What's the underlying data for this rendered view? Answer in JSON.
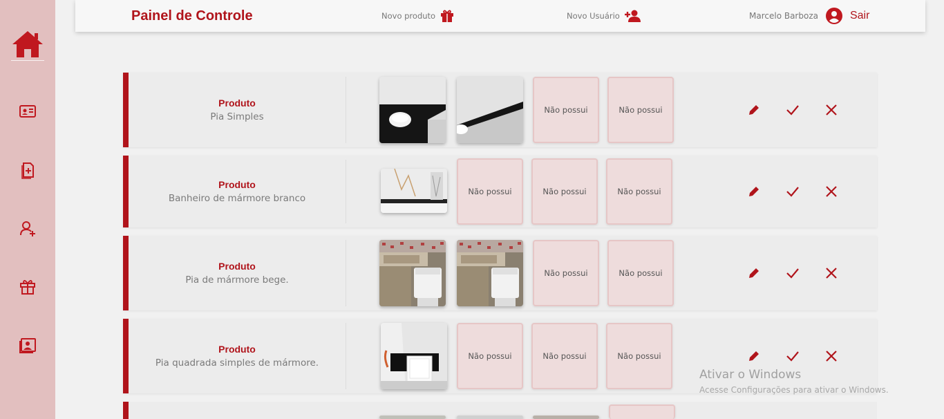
{
  "header": {
    "title": "Painel de Controle",
    "new_product": "Novo produto",
    "new_user": "Novo Usuário",
    "user_name": "Marcelo Barboza",
    "logout": "Sair"
  },
  "sidebar": {
    "items": [
      "home-icon",
      "id-card-icon",
      "document-add-icon",
      "user-add-icon",
      "gift-icon",
      "user-badge-icon"
    ]
  },
  "product_label": "Produto",
  "empty_slot": "Não possui",
  "products": [
    {
      "name": "Pia Simples"
    },
    {
      "name": "Banheiro de mármore branco"
    },
    {
      "name": "Pia de mármore bege."
    },
    {
      "name": "Pia quadrada simples de mármore."
    }
  ],
  "colors": {
    "accent": "#b0141b",
    "sidebar": "#e2bfbf",
    "empty_slot": "#eedcdc"
  },
  "watermark": {
    "title": "Ativar o Windows",
    "subtitle": "Acesse Configurações para ativar o Windows."
  }
}
